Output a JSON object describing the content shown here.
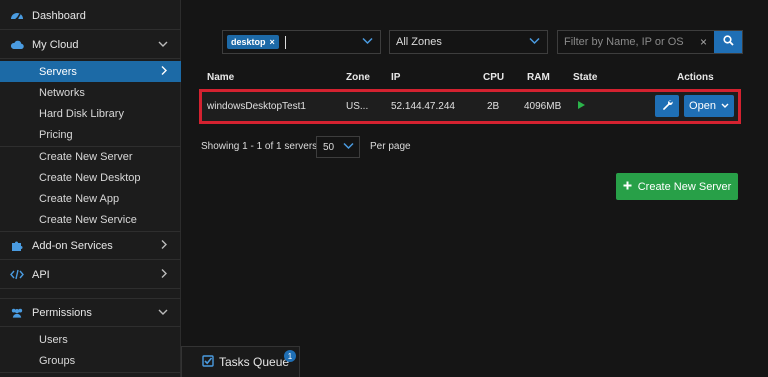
{
  "sidebar": {
    "dashboard": "Dashboard",
    "my_cloud": "My Cloud",
    "cloud_items": [
      "Servers",
      "Networks",
      "Hard Disk Library",
      "Pricing",
      "Create New Server",
      "Create New Desktop",
      "Create New App",
      "Create New Service"
    ],
    "addon": "Add-on Services",
    "api": "API",
    "permissions": "Permissions",
    "permission_items": [
      "Users",
      "Groups"
    ]
  },
  "filters": {
    "tag": "desktop",
    "tag_remove": "×",
    "zone": "All Zones",
    "search_placeholder": "Filter by Name, IP or OS",
    "search_clear": "×"
  },
  "table": {
    "columns": [
      "Name",
      "Zone",
      "IP",
      "CPU",
      "RAM",
      "State",
      "Actions"
    ],
    "rows": [
      {
        "name": "windowsDesktopTest1",
        "zone": "US...",
        "ip": "52.144.47.244",
        "cpu": "2B",
        "ram": "4096MB",
        "state": "running",
        "action": "Open"
      }
    ]
  },
  "pagination": {
    "showing": "Showing 1 - 1 of 1 servers,",
    "per_page_value": "50",
    "per_page_label": "Per page"
  },
  "create_button": "Create New Server",
  "tasks": {
    "label": "Tasks Queue",
    "count": "1"
  },
  "colors": {
    "accent": "#1f6fb5",
    "highlight": "#d42230",
    "success": "#28a048",
    "running": "#2bb34a"
  },
  "icons": [
    "dashboard-icon",
    "cloud-icon",
    "puzzle-icon",
    "code-icon",
    "users-icon",
    "search-icon",
    "wrench-icon",
    "plus-icon",
    "checkbox-icon",
    "chevron-down-icon",
    "chevron-right-icon"
  ]
}
